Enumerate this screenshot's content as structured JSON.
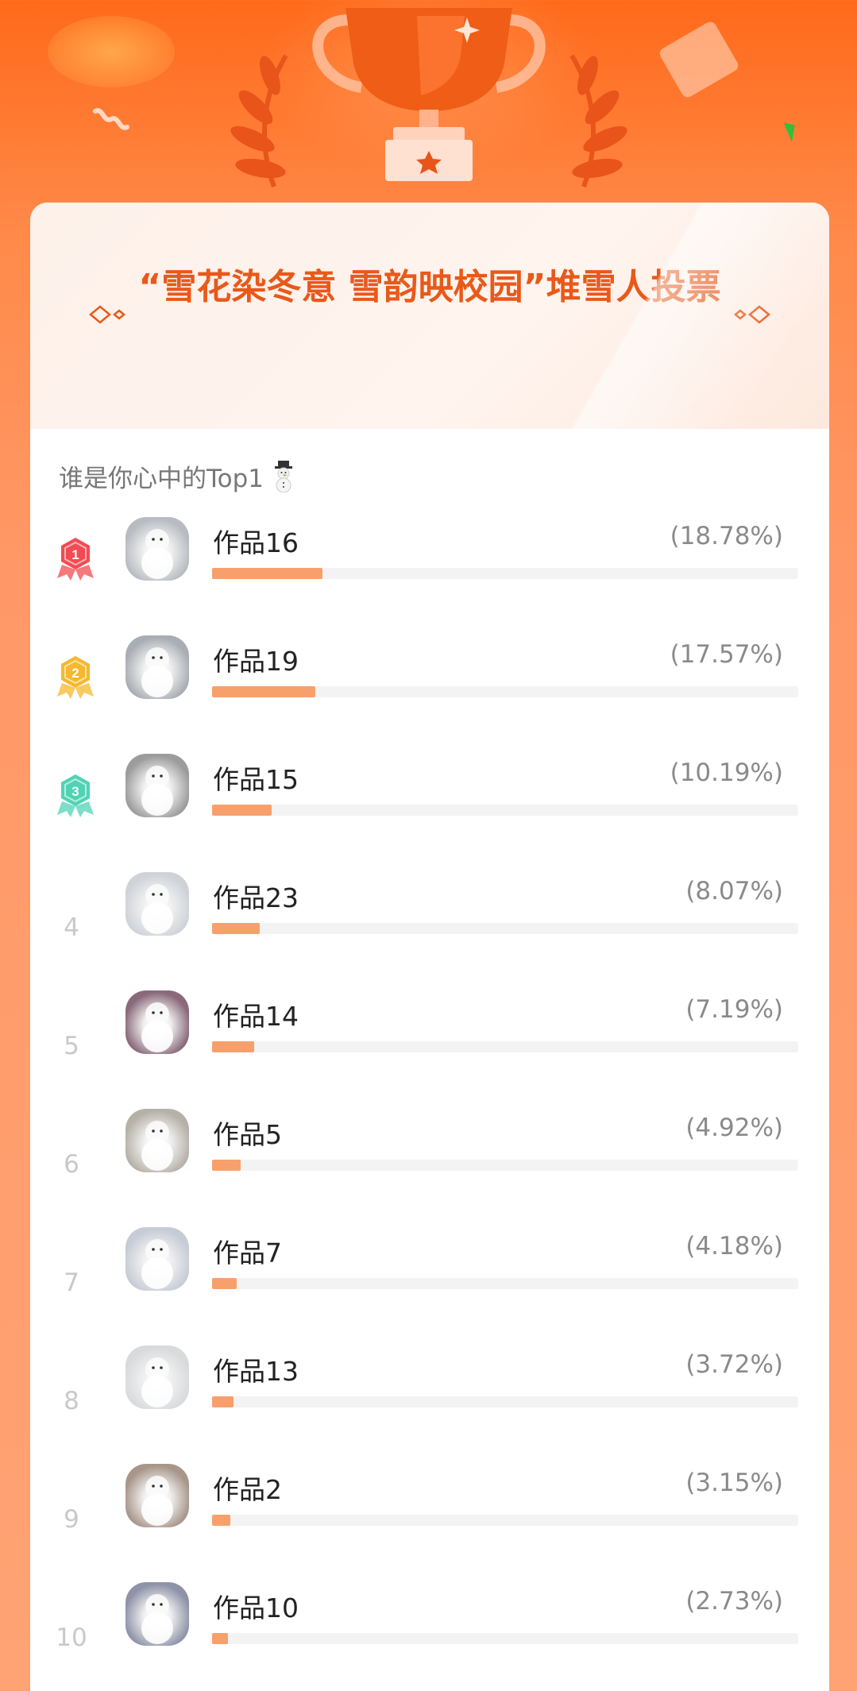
{
  "page": {
    "title": "“雪花染冬意 雪韵映校园”堆雪人投票",
    "subtitle": "谁是你心中的Top1"
  },
  "colors": {
    "accent": "#e8591a",
    "bar": "#f7a06c",
    "medal_gold": "#f44b52",
    "medal_silver": "#f5b82e",
    "medal_bronze": "#4fd3b5"
  },
  "icons": [
    "trophy-icon",
    "laurel-icon",
    "star-icon",
    "diamond-deco-icon",
    "snowman-emoji-icon",
    "medal-icon"
  ],
  "ranking": [
    {
      "rank": "1",
      "name": "作品16",
      "pct": "(18.78%)",
      "value": 18.78,
      "thumb": "#b8bcc2"
    },
    {
      "rank": "2",
      "name": "作品19",
      "pct": "(17.57%)",
      "value": 17.57,
      "thumb": "#a9adb4"
    },
    {
      "rank": "3",
      "name": "作品15",
      "pct": "(10.19%)",
      "value": 10.19,
      "thumb": "#9c9c9c"
    },
    {
      "rank": "4",
      "name": "作品23",
      "pct": "(8.07%)",
      "value": 8.07,
      "thumb": "#cfd3d8"
    },
    {
      "rank": "5",
      "name": "作品14",
      "pct": "(7.19%)",
      "value": 7.19,
      "thumb": "#8a6a7a"
    },
    {
      "rank": "6",
      "name": "作品5",
      "pct": "(4.92%)",
      "value": 4.92,
      "thumb": "#b6b1a8"
    },
    {
      "rank": "7",
      "name": "作品7",
      "pct": "(4.18%)",
      "value": 4.18,
      "thumb": "#c6ccd6"
    },
    {
      "rank": "8",
      "name": "作品13",
      "pct": "(3.72%)",
      "value": 3.72,
      "thumb": "#d8dadc"
    },
    {
      "rank": "9",
      "name": "作品2",
      "pct": "(3.15%)",
      "value": 3.15,
      "thumb": "#a8968a"
    },
    {
      "rank": "10",
      "name": "作品10",
      "pct": "(2.73%)",
      "value": 2.73,
      "thumb": "#8e93a8"
    }
  ]
}
